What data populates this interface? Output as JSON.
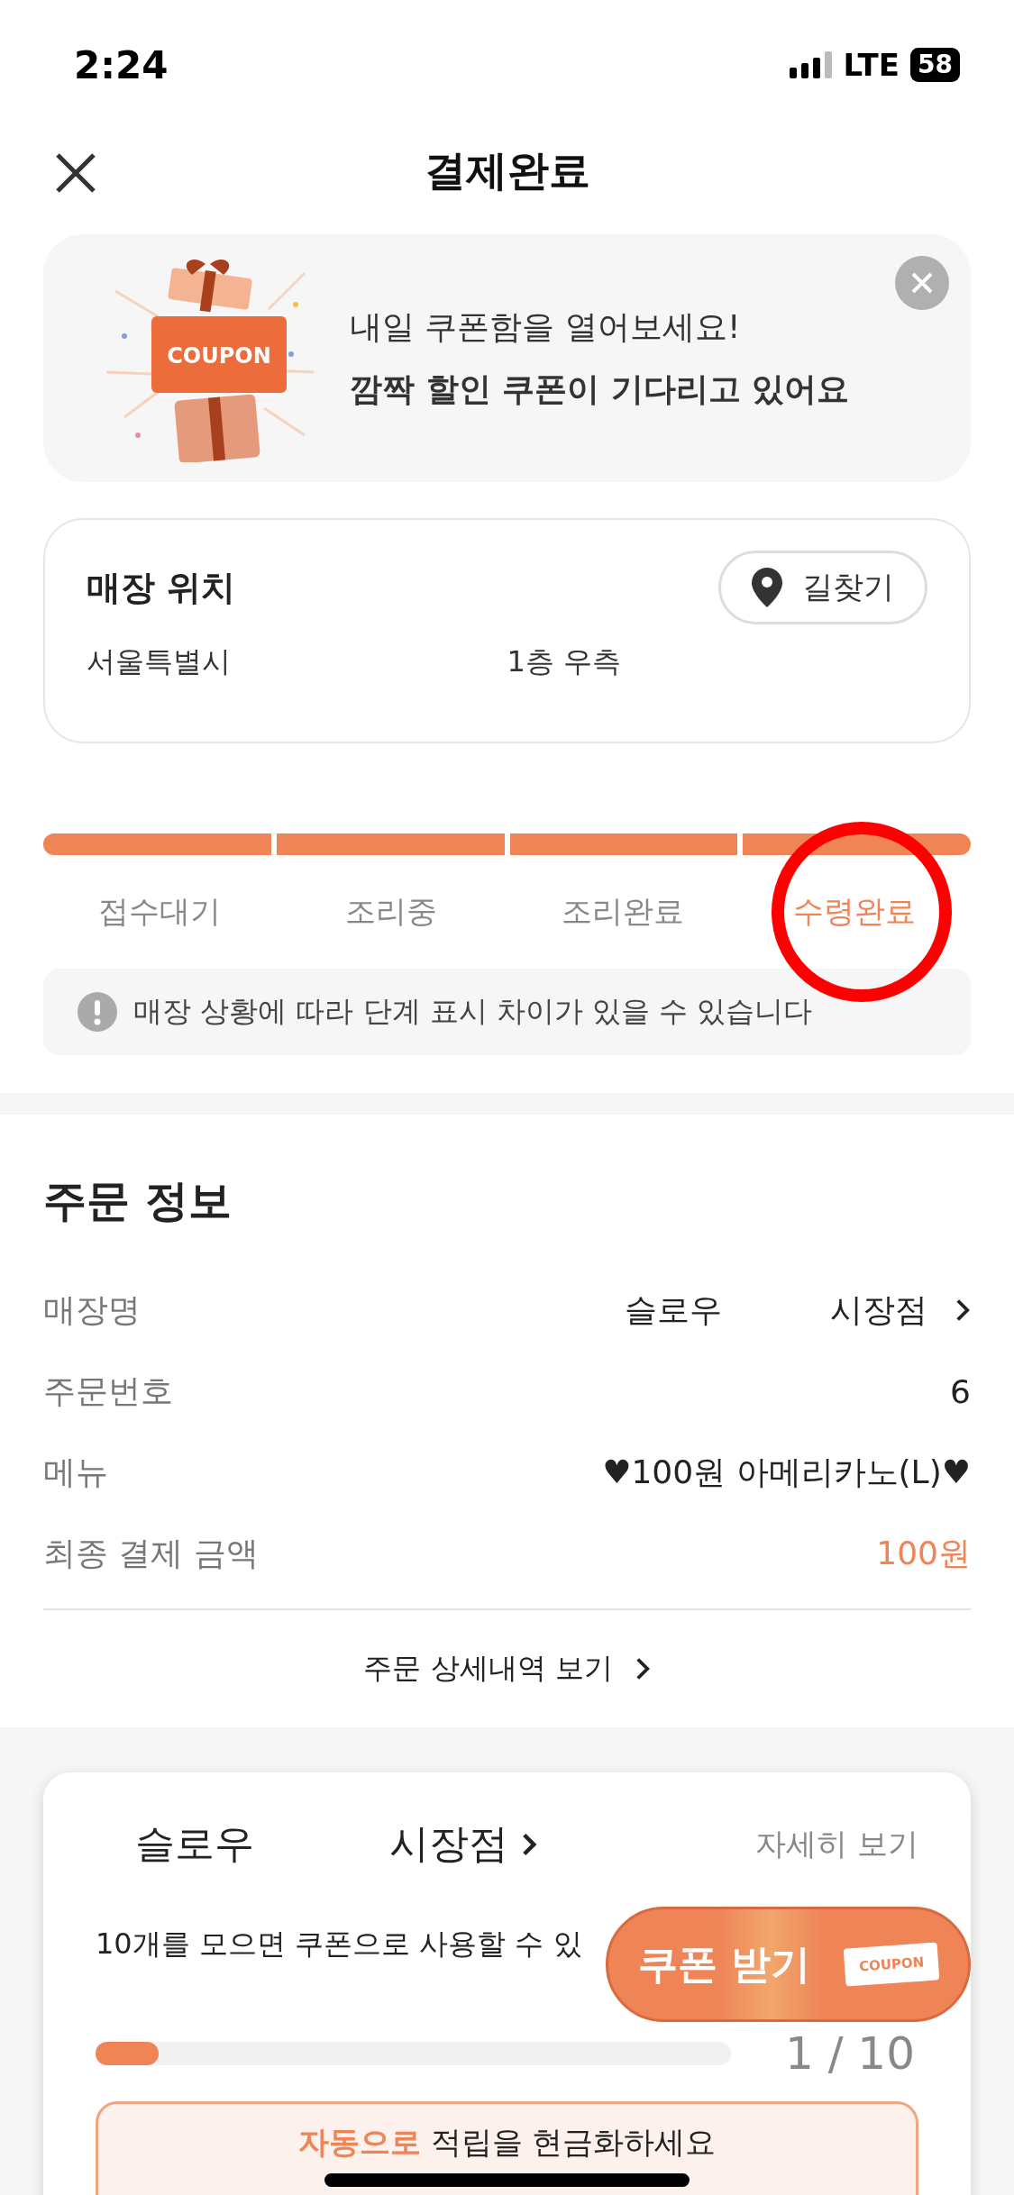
{
  "status_bar": {
    "time": "2:24",
    "network": "LTE",
    "battery": "58"
  },
  "header": {
    "title": "결제완료"
  },
  "coupon_banner": {
    "line1": "내일 쿠폰함을 열어보세요!",
    "line2": "깜짝 할인 쿠폰이 기다리고 있어요",
    "art_label": "COUPON"
  },
  "store_location": {
    "title": "매장 위치",
    "directions_button": "길찾기",
    "address": "서울특별시",
    "detail": "1층 우측"
  },
  "order_steps": {
    "steps": [
      {
        "label": "접수대기",
        "selected": false,
        "circled": false
      },
      {
        "label": "조리중",
        "selected": false,
        "circled": false
      },
      {
        "label": "조리완료",
        "selected": false,
        "circled": false
      },
      {
        "label": "수령완료",
        "selected": true,
        "circled": true
      }
    ],
    "notice": "매장 상황에 따라 단계 표시 차이가 있을 수 있습니다"
  },
  "order_info": {
    "title": "주문 정보",
    "rows": [
      {
        "kind": "link",
        "label": "매장명",
        "value_parts": [
          "슬로우",
          "시장점"
        ]
      },
      {
        "kind": "text",
        "label": "주문번호",
        "value": "6"
      },
      {
        "kind": "text",
        "label": "메뉴",
        "value": "♥100원 아메리카노(L)♥"
      },
      {
        "kind": "price",
        "label": "최종 결제 금액",
        "value": "100원"
      }
    ],
    "detail_link": "주문 상세내역 보기"
  },
  "stamp_card": {
    "store_parts": [
      "슬로우",
      "시장점"
    ],
    "more": "자세히 보기",
    "description": "10개를 모으면 쿠폰으로 사용할 수 있",
    "level": 0.1,
    "count": "1 / 10",
    "notice_highlight": "자동으로",
    "notice_rest": "적립을 현금화하세요"
  },
  "coupon_button": {
    "label": "쿠폰 받기",
    "ticket": "COUPON"
  }
}
